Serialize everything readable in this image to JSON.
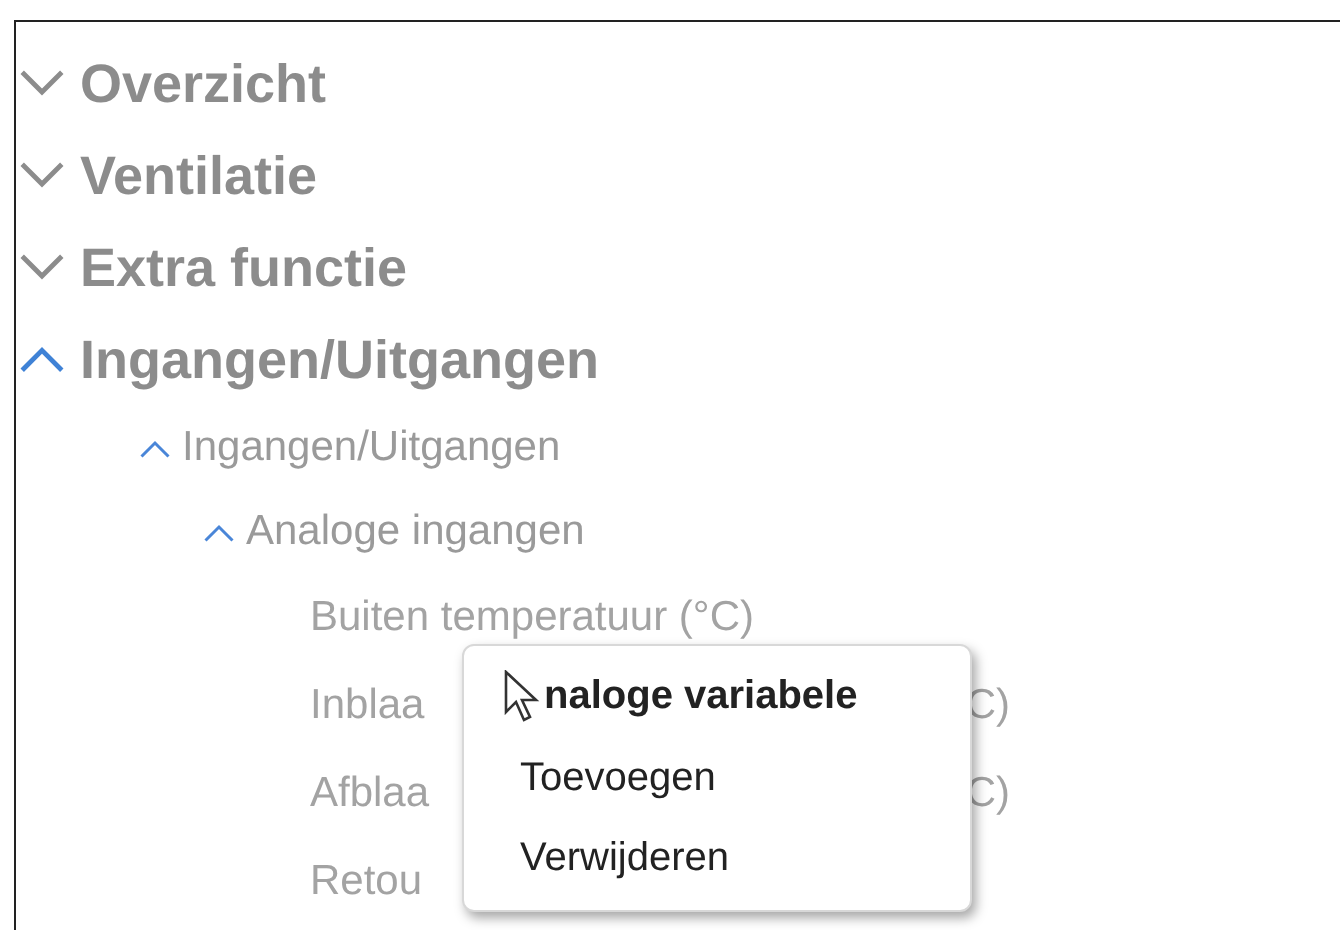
{
  "tree": [
    {
      "label": "Overzicht",
      "expanded": false
    },
    {
      "label": "Ventilatie",
      "expanded": false
    },
    {
      "label": "Extra functie",
      "expanded": false
    },
    {
      "label": "Ingangen/Uitgangen",
      "expanded": true,
      "children": [
        {
          "label": "Ingangen/Uitgangen",
          "expanded": true,
          "children": [
            {
              "label": "Analoge ingangen",
              "expanded": true,
              "children": [
                {
                  "parts": [
                    "Buiten temperatuur (°C)"
                  ]
                },
                {
                  "parts": [
                    "Inblaa",
                    "C)"
                  ]
                },
                {
                  "parts": [
                    "Afblaa",
                    "C)"
                  ]
                },
                {
                  "parts": [
                    "Retou"
                  ]
                }
              ]
            }
          ]
        }
      ]
    }
  ],
  "context_menu": {
    "title": "naloge variabele",
    "items": [
      "Toevoegen",
      "Verwijderen"
    ]
  }
}
